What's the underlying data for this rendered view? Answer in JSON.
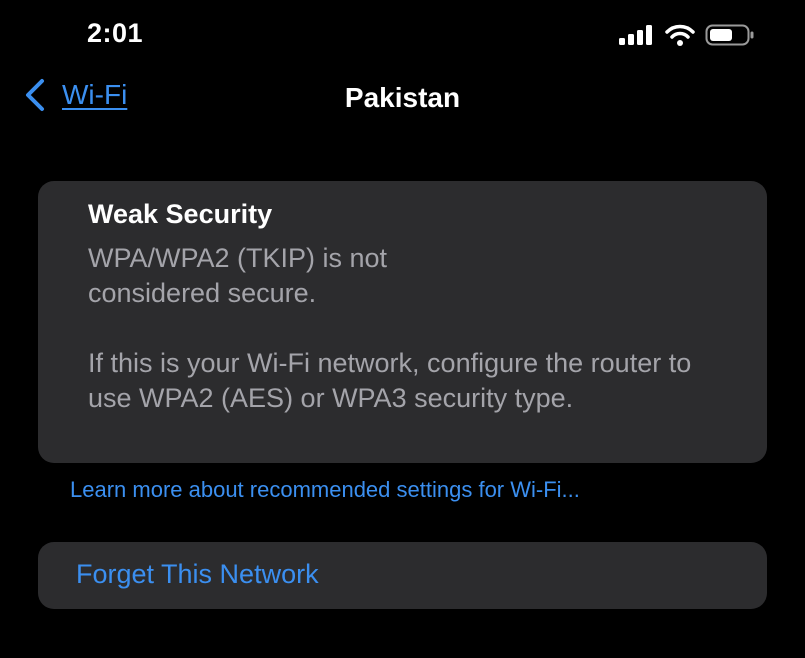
{
  "status_bar": {
    "time": "2:01",
    "icons": [
      "signal-icon",
      "wifi-icon",
      "battery-icon"
    ]
  },
  "nav": {
    "back_label": "Wi-Fi",
    "title": "Pakistan"
  },
  "security_card": {
    "title": "Weak Security",
    "line_1": "WPA/WPA2 (TKIP) is not\nconsidered secure.",
    "line_2": "If this is your Wi-Fi network, configure the router to use WPA2 (AES) or WPA3 security type."
  },
  "learn_more": {
    "label": "Learn more about recommended settings for Wi-Fi..."
  },
  "forget": {
    "label": "Forget This Network"
  },
  "colors": {
    "background": "#000000",
    "card": "#2c2c2e",
    "accent": "#3b8ff0",
    "secondary_text": "#a4a4aa",
    "primary_text": "#ffffff"
  }
}
